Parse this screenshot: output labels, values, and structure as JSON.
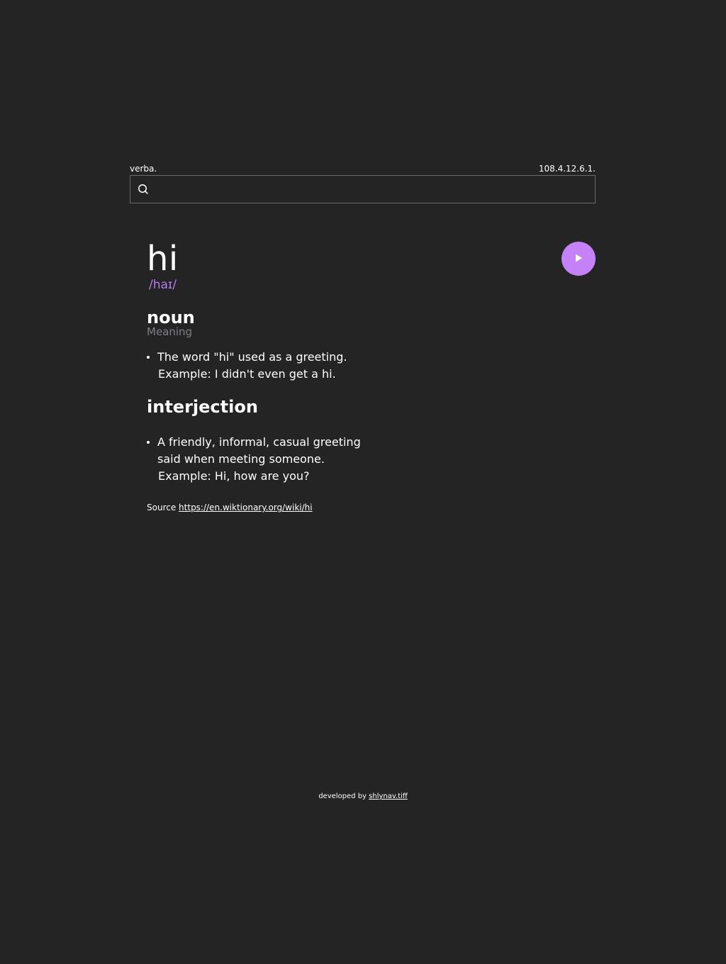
{
  "header": {
    "brand": "verba.",
    "version": "108.4.12.6.1."
  },
  "search": {
    "icon": "search-icon",
    "value": "",
    "placeholder": ""
  },
  "entry": {
    "word": "hi",
    "phonetic": "/haɪ/",
    "play_icon": "play-icon",
    "meanings": [
      {
        "part_of_speech": "noun",
        "label": "Meaning",
        "definitions": [
          {
            "definition": "The word \"hi\" used as a greeting.",
            "example": "Example: I didn't even get a hi."
          }
        ]
      },
      {
        "part_of_speech": "interjection",
        "definitions": [
          {
            "definition": "A friendly, informal, casual greeting said when meeting someone.",
            "example": "Example: Hi, how are you?"
          }
        ]
      }
    ],
    "source_label": "Source",
    "source_url": "https://en.wiktionary.org/wiki/hi"
  },
  "footer": {
    "text": "developed by",
    "author": "shlynav.tiff"
  },
  "colors": {
    "background": "#242424",
    "accent": "#c581f7",
    "phonetic": "#b57bf2",
    "muted": "#7d7f87"
  }
}
